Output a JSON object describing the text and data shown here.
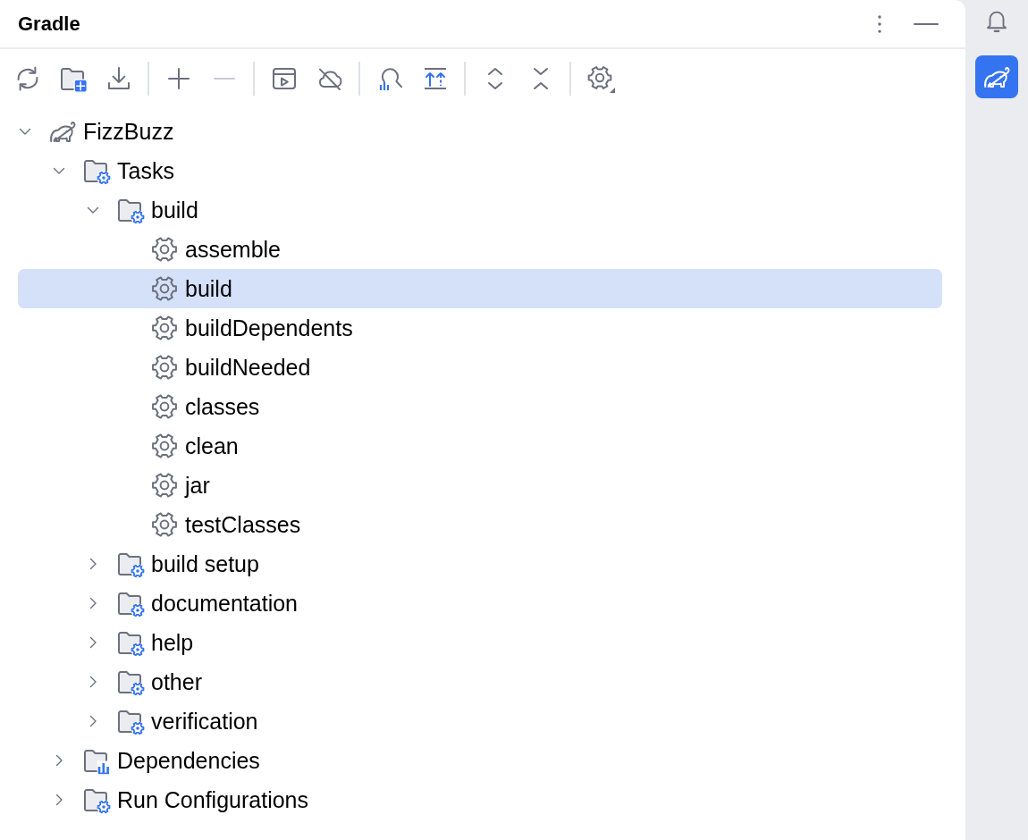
{
  "panel": {
    "title": "Gradle"
  },
  "toolbar_groups": [
    {
      "buttons": [
        {
          "kind": "reload",
          "disabled": false
        },
        {
          "kind": "attach",
          "disabled": false
        },
        {
          "kind": "download",
          "disabled": false
        }
      ]
    },
    {
      "buttons": [
        {
          "kind": "add",
          "disabled": false
        },
        {
          "kind": "remove",
          "disabled": true
        }
      ]
    },
    {
      "buttons": [
        {
          "kind": "run",
          "disabled": false
        },
        {
          "kind": "offline",
          "disabled": false
        }
      ]
    },
    {
      "buttons": [
        {
          "kind": "analyze",
          "disabled": false
        },
        {
          "kind": "toggle",
          "disabled": false
        }
      ]
    },
    {
      "buttons": [
        {
          "kind": "expand",
          "disabled": false
        },
        {
          "kind": "collapse",
          "disabled": false
        }
      ]
    },
    {
      "buttons": [
        {
          "kind": "settings",
          "disabled": false
        }
      ]
    }
  ],
  "tree": [
    {
      "label": "FizzBuzz",
      "kind": "project",
      "expanded": true,
      "selected": false,
      "children": [
        {
          "label": "Tasks",
          "kind": "folder",
          "expanded": true,
          "selected": false,
          "children": [
            {
              "label": "build",
              "kind": "folder",
              "expanded": true,
              "selected": false,
              "children": [
                {
                  "label": "assemble",
                  "kind": "task",
                  "selected": false
                },
                {
                  "label": "build",
                  "kind": "task",
                  "selected": true
                },
                {
                  "label": "buildDependents",
                  "kind": "task",
                  "selected": false
                },
                {
                  "label": "buildNeeded",
                  "kind": "task",
                  "selected": false
                },
                {
                  "label": "classes",
                  "kind": "task",
                  "selected": false
                },
                {
                  "label": "clean",
                  "kind": "task",
                  "selected": false
                },
                {
                  "label": "jar",
                  "kind": "task",
                  "selected": false
                },
                {
                  "label": "testClasses",
                  "kind": "task",
                  "selected": false
                }
              ]
            },
            {
              "label": "build setup",
              "kind": "folder",
              "expanded": false,
              "selected": false
            },
            {
              "label": "documentation",
              "kind": "folder",
              "expanded": false,
              "selected": false
            },
            {
              "label": "help",
              "kind": "folder",
              "expanded": false,
              "selected": false
            },
            {
              "label": "other",
              "kind": "folder",
              "expanded": false,
              "selected": false
            },
            {
              "label": "verification",
              "kind": "folder",
              "expanded": false,
              "selected": false
            }
          ]
        },
        {
          "label": "Dependencies",
          "kind": "dependencies",
          "expanded": false,
          "selected": false
        },
        {
          "label": "Run Configurations",
          "kind": "folder",
          "expanded": false,
          "selected": false
        }
      ]
    }
  ],
  "side_tools": [
    {
      "kind": "notifications",
      "selected": false
    },
    {
      "kind": "gradle",
      "selected": true
    }
  ]
}
